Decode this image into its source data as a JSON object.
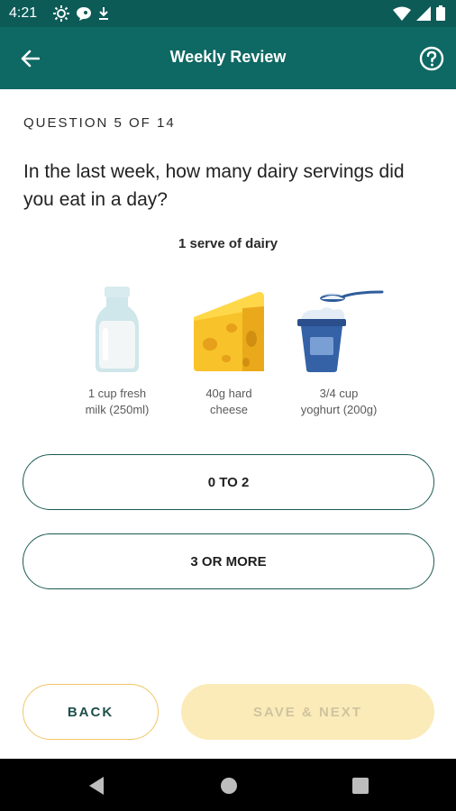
{
  "status_bar": {
    "time": "4:21",
    "left_icons": [
      "brightness-icon",
      "chat-bubble-icon",
      "download-icon"
    ],
    "right_icons": [
      "wifi-icon",
      "signal-icon",
      "battery-icon"
    ]
  },
  "app_bar": {
    "title": "Weekly Review",
    "back_icon": "arrow-left-icon",
    "help_icon": "help-circle-icon"
  },
  "question": {
    "counter": "QUESTION 5 OF 14",
    "text": "In the last week, how many dairy servings did you eat in a day?"
  },
  "serve_info": {
    "heading": "1 serve of dairy",
    "items": [
      {
        "icon": "milk-bottle-icon",
        "caption_line1": "1 cup fresh",
        "caption_line2": "milk (250ml)"
      },
      {
        "icon": "cheese-icon",
        "caption_line1": "40g hard",
        "caption_line2": "cheese"
      },
      {
        "icon": "yoghurt-icon",
        "caption_line1": "3/4 cup",
        "caption_line2": "yoghurt (200g)"
      }
    ]
  },
  "options": [
    {
      "label": "0 TO 2"
    },
    {
      "label": "3 OR MORE"
    }
  ],
  "footer": {
    "back_label": "BACK",
    "save_next_label": "SAVE & NEXT"
  },
  "colors": {
    "app_bar": "#0e6863",
    "status_bar": "#0c5b57",
    "option_border": "#1a5a52",
    "back_border": "#f0c568",
    "save_next_bg": "#fbebb8",
    "save_next_text": "#d0c3a0"
  },
  "nav_bar": {
    "icons": [
      "nav-back-icon",
      "nav-home-icon",
      "nav-recents-icon"
    ]
  }
}
